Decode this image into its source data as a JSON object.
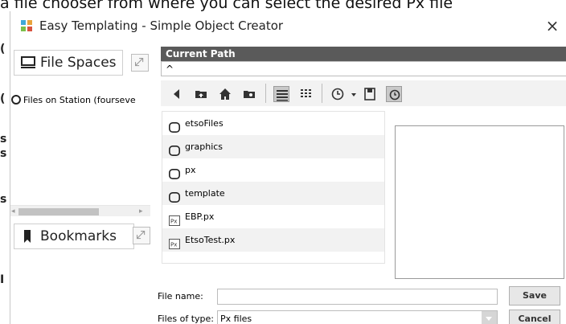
{
  "background": {
    "caption": "a file chooser from where you can select the desired Px file",
    "letters": [
      "(",
      "(",
      "s",
      "s",
      "(",
      "(",
      "s",
      "I",
      "("
    ]
  },
  "window": {
    "title": "Easy Templating - Simple Object Creator",
    "close_label": "×"
  },
  "side_panel": {
    "file_spaces_label": "File Spaces",
    "tree_item": "Files on Station (fourseve",
    "bookmarks_label": "Bookmarks"
  },
  "chooser": {
    "current_path_label": "Current Path",
    "current_path_value": "^",
    "files": [
      {
        "name": "etsoFiles",
        "type": "folder"
      },
      {
        "name": "graphics",
        "type": "folder"
      },
      {
        "name": "px",
        "type": "folder"
      },
      {
        "name": "template",
        "type": "folder"
      },
      {
        "name": "EBP.px",
        "type": "px"
      },
      {
        "name": "EtsoTest.px",
        "type": "px"
      }
    ],
    "file_name_label": "File name:",
    "file_name_value": "",
    "files_of_type_label": "Files of type:",
    "files_of_type_value": "Px files",
    "save_label": "Save",
    "cancel_label": "Cancel"
  },
  "toolbar": {
    "icons": [
      "back-icon",
      "folder-up-icon",
      "home-icon",
      "new-folder-icon",
      "list-view-icon",
      "details-view-icon",
      "history-icon",
      "history-dropdown-icon",
      "bookmark-add-icon",
      "refresh-icon"
    ]
  },
  "colors": {
    "header_bg": "#5a5a5a",
    "row_alt": "#f2f2f2",
    "toolbar_bg": "#f2f2f2"
  }
}
